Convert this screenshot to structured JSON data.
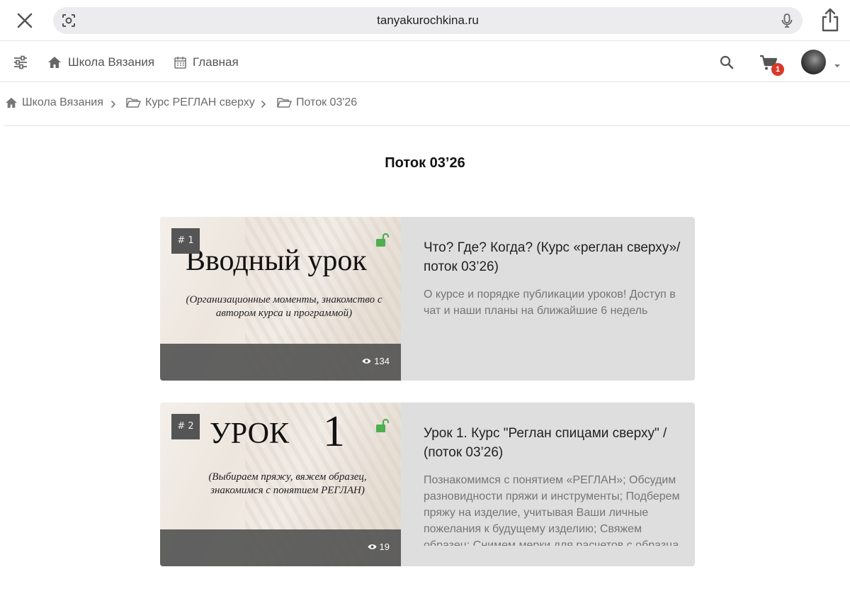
{
  "browser": {
    "url": "tanyakurochkina.ru"
  },
  "nav": {
    "school_label": "Школа Вязания",
    "home_label": "Главная",
    "cart_count": "1"
  },
  "breadcrumb": {
    "items": [
      "Школа Вязания",
      "Курс РЕГЛАН сверху",
      "Поток 03'26"
    ]
  },
  "page": {
    "title": "Поток 03’26"
  },
  "lessons": [
    {
      "number": "# 1",
      "thumb_title": "Вводный урок",
      "thumb_subtitle": "(Организационные моменты, знакомство с автором курса и программой)",
      "views": "134",
      "heading": "Что? Где? Когда? (Курс «реглан сверху»/ поток 03’26)",
      "description": "О курсе и порядке публикации уроков! Доступ в чат и наши планы на ближайшие 6 недель"
    },
    {
      "number": "# 2",
      "thumb_title": "УРОК",
      "thumb_number": "1",
      "thumb_subtitle": "(Выбираем пряжу, вяжем образец, знакомимся с понятием РЕГЛАН)",
      "views": "19",
      "heading": "Урок 1. Курс \"Реглан спицами сверху\" / (поток 03’26)",
      "description": "Познакомимся с понятием «РЕГЛАН»; Обсудим разновидности пряжи и инструменты; Подберем пряжу на изделие, учитывая Ваши личные пожелания к будущему изделию; Свяжем образец; Снимем мерки для расчетов с образца"
    }
  ],
  "colors": {
    "unlock_green": "#4caf50",
    "badge_red": "#d9392a",
    "card_bg": "#dedede"
  }
}
